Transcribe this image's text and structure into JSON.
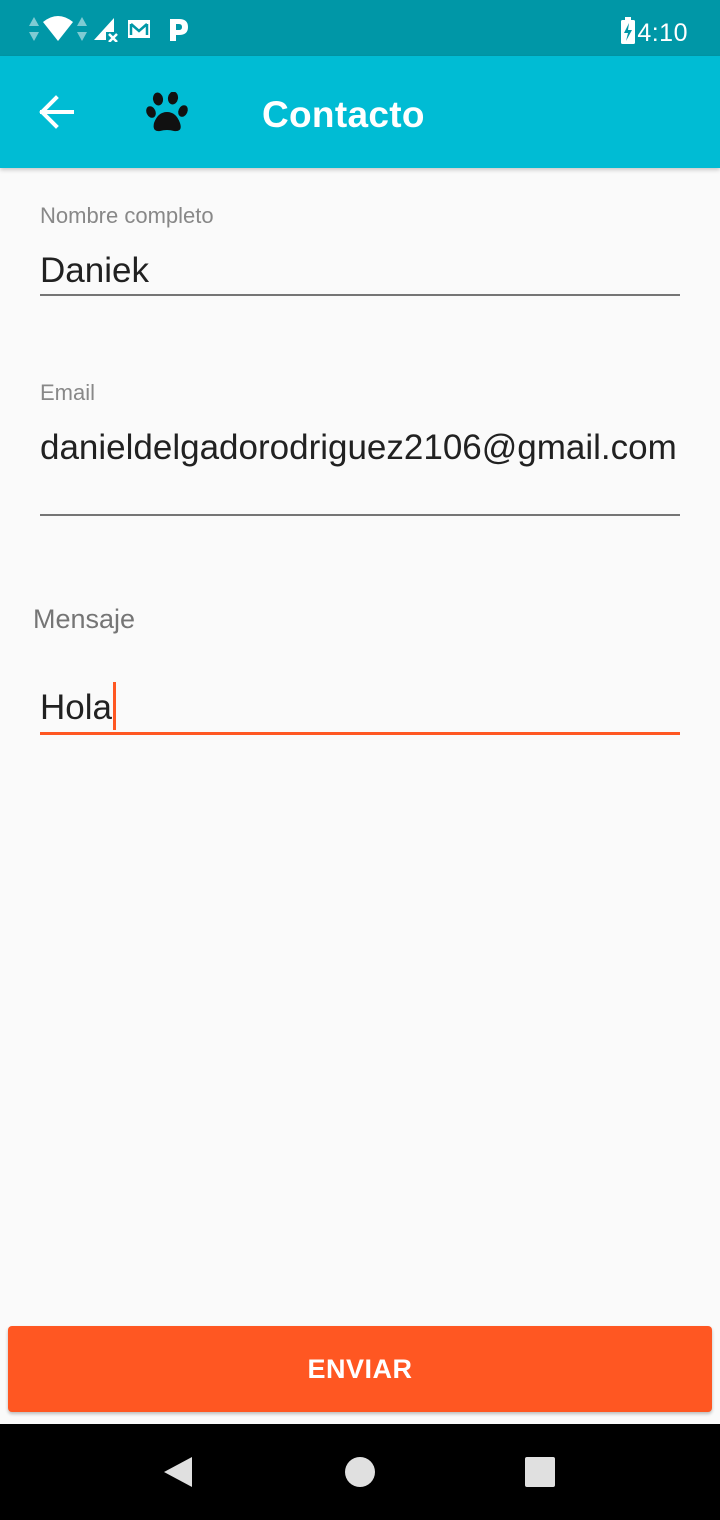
{
  "status_bar": {
    "time": "4:10",
    "icons": [
      "data-arrows-icon",
      "wifi-icon",
      "data-arrows-icon",
      "signal-no-sim-icon",
      "gmail-icon",
      "parking-app-icon",
      "battery-charging-icon"
    ]
  },
  "app_bar": {
    "title": "Contacto",
    "back_icon": "arrow-back-icon",
    "logo_icon": "paw-icon"
  },
  "form": {
    "name_label": "Nombre completo",
    "name_value": "Daniek",
    "email_label": "Email",
    "email_value": "danieldelgadorodriguez2106@gmail.com",
    "message_label": "Mensaje",
    "message_value": "Hola"
  },
  "send_button": {
    "label": "ENVIAR"
  },
  "colors": {
    "status_bar": "#0097a7",
    "app_bar": "#00bcd4",
    "accent": "#ff5722",
    "background": "#fafafa"
  },
  "nav_bar": {
    "icons": [
      "nav-back-icon",
      "nav-home-icon",
      "nav-recents-icon"
    ]
  }
}
